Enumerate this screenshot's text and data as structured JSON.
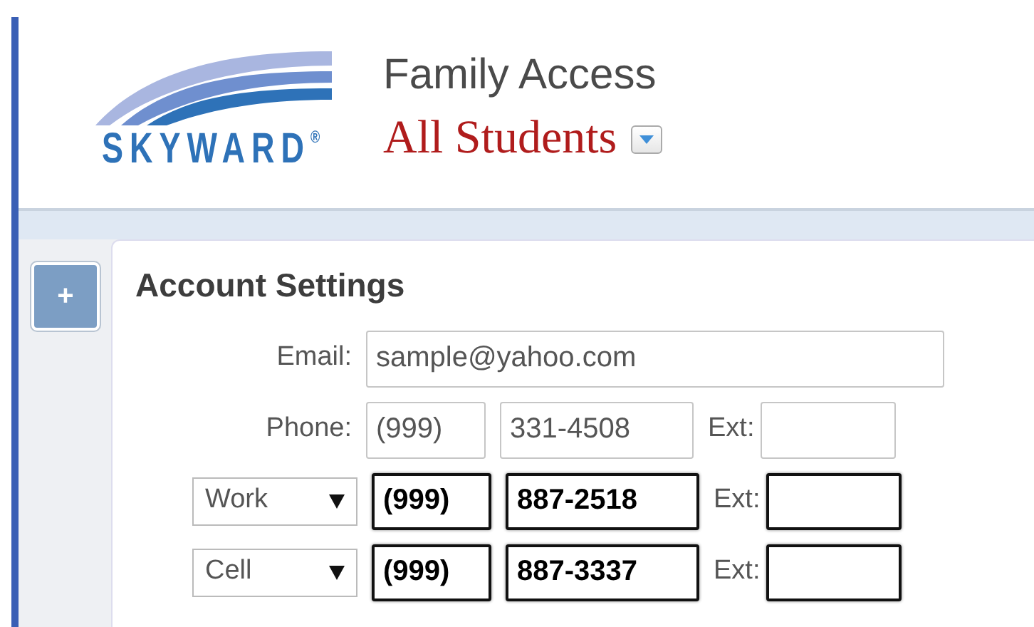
{
  "header": {
    "logo_text": "SKYWARD",
    "logo_mark": "®",
    "app_title": "Family Access",
    "student_selector": "All Students"
  },
  "panel": {
    "title": "Account Settings",
    "email": {
      "label": "Email:",
      "value": "sample@yahoo.com"
    },
    "phones": [
      {
        "kind": "label",
        "label": "Phone:",
        "area": "(999)",
        "number": "331-4508",
        "ext_label": "Ext:",
        "highlighted": false
      },
      {
        "kind": "select",
        "label": "Work",
        "area": "(999)",
        "number": "887-2518",
        "ext_label": "Ext:",
        "highlighted": true
      },
      {
        "kind": "select",
        "label": "Cell",
        "area": "(999)",
        "number": "887-3337",
        "ext_label": "Ext:",
        "highlighted": true
      }
    ]
  },
  "sidebar": {
    "expand_button": "+"
  }
}
